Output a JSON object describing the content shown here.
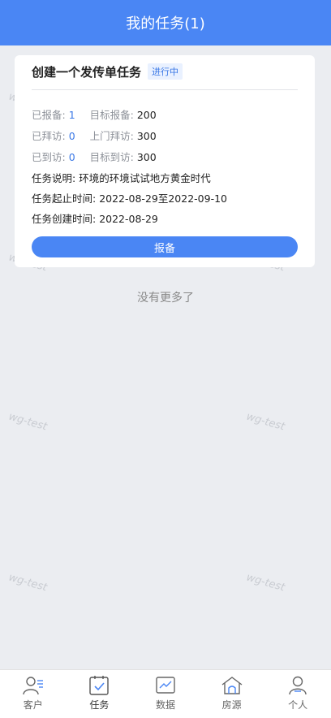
{
  "header": {
    "title": "我的任务(1)"
  },
  "task": {
    "title": "创建一个发传单任务",
    "status": "进行中",
    "reported_label": "已报备:",
    "reported_value": "1",
    "target_report_label": "目标报备:",
    "target_report_value": "200",
    "visited_label": "已拜访:",
    "visited_value": "0",
    "home_visit_label": "上门拜访:",
    "home_visit_value": "300",
    "arrived_label": "已到访:",
    "arrived_value": "0",
    "target_arrive_label": "目标到访:",
    "target_arrive_value": "300",
    "desc_label": "任务说明:",
    "desc_value": "环境的环境试试地方黄金时代",
    "period_label": "任务起止时间:",
    "period_value": "2022-08-29至2022-09-10",
    "created_label": "任务创建时间:",
    "created_value": "2022-08-29",
    "button_label": "报备"
  },
  "no_more": "没有更多了",
  "watermark": "wg-test",
  "tabbar": [
    {
      "label": "客户",
      "icon": "customer-icon"
    },
    {
      "label": "任务",
      "icon": "task-icon"
    },
    {
      "label": "数据",
      "icon": "chart-icon"
    },
    {
      "label": "房源",
      "icon": "house-icon"
    },
    {
      "label": "个人",
      "icon": "person-icon"
    }
  ],
  "colors": {
    "primary": "#4a86f4",
    "accent_text": "#3a78e6",
    "background": "#ebedf1"
  }
}
